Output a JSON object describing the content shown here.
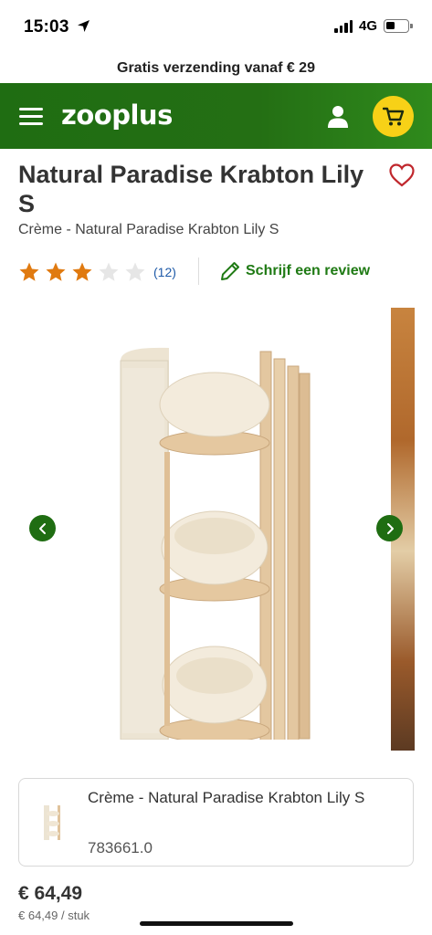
{
  "status_bar": {
    "time": "15:03",
    "network": "4G"
  },
  "promo": {
    "text": "Gratis verzending vanaf € 29"
  },
  "header": {
    "logo": "zooplus",
    "menu_icon": "hamburger-icon",
    "account_icon": "user-icon",
    "cart_icon": "cart-icon",
    "brand_color": "#246f14",
    "cart_color": "#f7d117"
  },
  "product": {
    "title": "Natural Paradise Krabton Lily S",
    "subtitle": "Crème - Natural Paradise Krabton Lily S",
    "rating": 3,
    "rating_max": 5,
    "review_count": "(12)",
    "write_review": "Schrijf een review"
  },
  "variant": {
    "name": "Crème - Natural Paradise Krabton Lily S",
    "code": "783661.0"
  },
  "pricing": {
    "price": "€ 64,49",
    "unit_price": "€ 64,49 / stuk"
  },
  "colors": {
    "star_filled": "#e07a10",
    "star_empty": "#e6e6e6",
    "link_green": "#1f7a14",
    "rating_link": "#1e5aa8"
  }
}
